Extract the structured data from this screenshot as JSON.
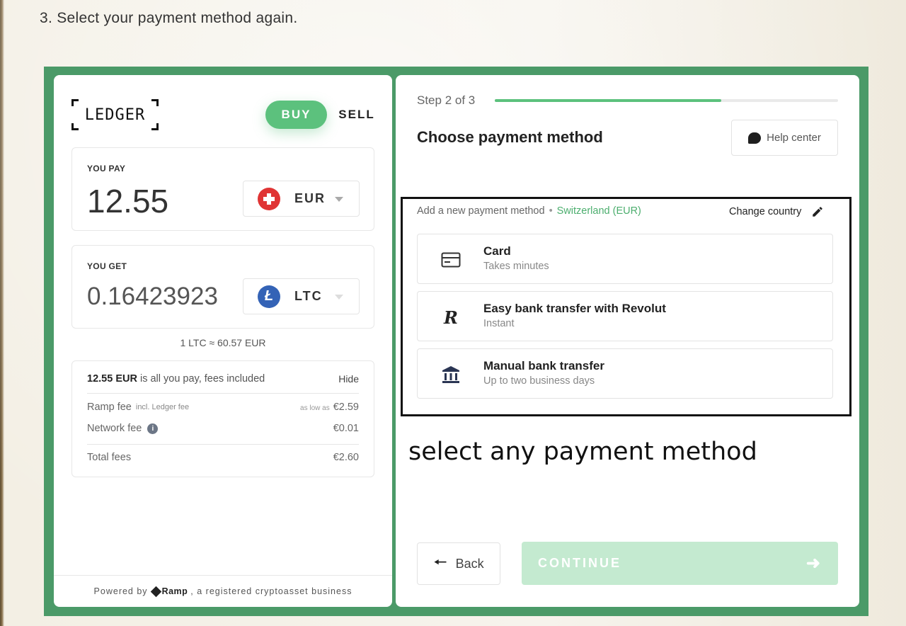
{
  "instruction": "3. Select your payment method again.",
  "annotation": "select any payment method",
  "brand": {
    "logo_text": "LEDGER",
    "accent_color": "#5cc17d",
    "frame_color": "#4b9a68"
  },
  "mode_toggle": {
    "buy": "BUY",
    "sell": "SELL",
    "selected": "BUY"
  },
  "pay": {
    "label": "YOU PAY",
    "amount": "12.55",
    "currency": "EUR",
    "flag_icon": "switzerland-flag-icon"
  },
  "get": {
    "label": "YOU GET",
    "amount": "0.16423923",
    "currency": "LTC",
    "coin_icon": "litecoin-icon",
    "coin_symbol": "Ł"
  },
  "rate": "1 LTC ≈ 60.57 EUR",
  "fees": {
    "summary_amount": "12.55 EUR",
    "summary_text": " is all you pay, fees included",
    "hide": "Hide",
    "ramp_fee_label": "Ramp fee",
    "ramp_fee_note": "incl. Ledger fee",
    "ramp_fee_prefix": "as low as",
    "ramp_fee_value": "€2.59",
    "network_fee_label": "Network fee",
    "network_fee_value": "€0.01",
    "total_label": "Total fees",
    "total_value": "€2.60"
  },
  "footer": {
    "powered_by": "Powered by",
    "ramp": "Ramp",
    "suffix": ", a registered cryptoasset business"
  },
  "step": {
    "text": "Step 2 of 3",
    "progress": 0.66
  },
  "title": "Choose payment method",
  "help_center": "Help center",
  "add_method": {
    "label": "Add a new payment method",
    "country": "Switzerland (EUR)",
    "change_country": "Change country"
  },
  "methods": [
    {
      "title": "Card",
      "subtitle": "Takes minutes",
      "icon": "credit-card-icon"
    },
    {
      "title": "Easy bank transfer with Revolut",
      "subtitle": "Instant",
      "icon": "revolut-icon",
      "glyph": "R"
    },
    {
      "title": "Manual bank transfer",
      "subtitle": "Up to two business days",
      "icon": "bank-icon"
    }
  ],
  "back": "Back",
  "continue": "CONTINUE"
}
